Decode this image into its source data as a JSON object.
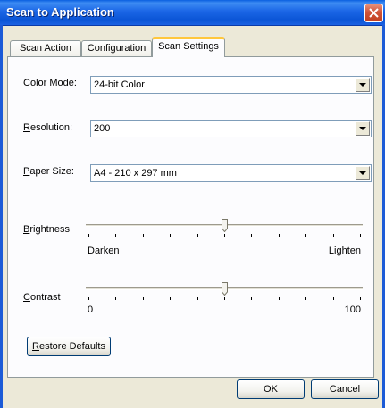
{
  "window": {
    "title": "Scan to Application"
  },
  "tabs": [
    {
      "label": "Scan Action",
      "selected": false
    },
    {
      "label": "Configuration",
      "selected": false
    },
    {
      "label": "Scan Settings",
      "selected": true
    }
  ],
  "settings": {
    "color_mode": {
      "label_underline": "C",
      "label_rest": "olor Mode:",
      "value": "24-bit Color"
    },
    "resolution": {
      "label_underline": "R",
      "label_rest": "esolution:",
      "value": "200"
    },
    "paper_size": {
      "label_underline": "P",
      "label_rest": "aper Size:",
      "value": "A4 - 210 x 297 mm"
    },
    "brightness": {
      "label_underline": "B",
      "label_rest": "rightness",
      "min_label": "Darken",
      "max_label": "Lighten",
      "level_fraction": 0.5
    },
    "contrast": {
      "label_underline": "C",
      "label_rest": "ontrast",
      "min_label": "0",
      "max_label": "100",
      "level_fraction": 0.5
    }
  },
  "buttons": {
    "restore_underline": "R",
    "restore_rest": "estore Defaults",
    "ok": "OK",
    "cancel": "Cancel"
  },
  "colors": {
    "titlebar": "#0b55d6",
    "dialog_background": "#ece9d8",
    "close_button": "#c2401f",
    "active_tab_accent": "#ffc73c"
  },
  "icons": [
    "close-icon",
    "dropdown-arrow-icon",
    "slider-thumb-icon"
  ]
}
